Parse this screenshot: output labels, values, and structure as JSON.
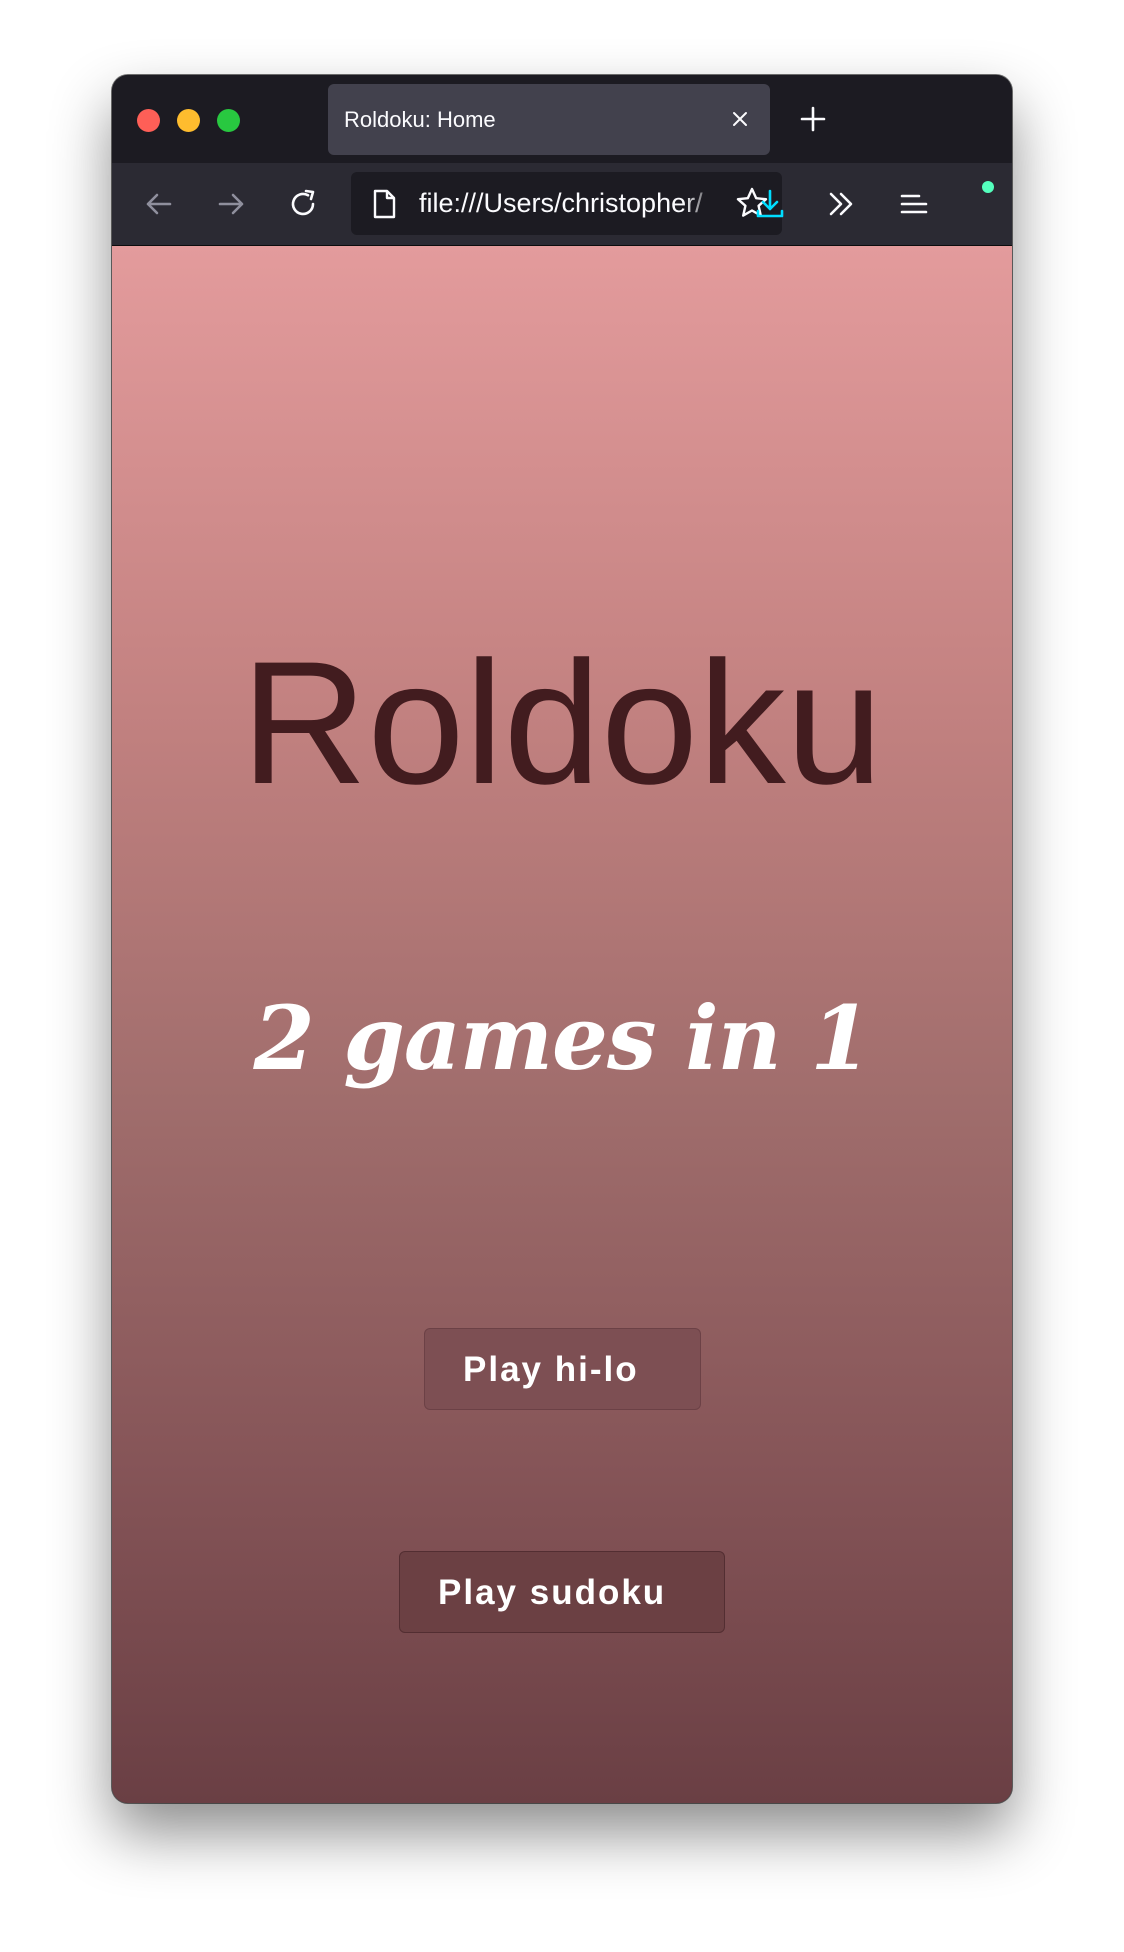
{
  "browser": {
    "tab_title": "Roldoku: Home",
    "url": "file:///Users/christopher/"
  },
  "icons": {
    "tab_close": "close-icon",
    "new_tab": "plus-icon",
    "back": "arrow-left-icon",
    "forward": "arrow-right-icon",
    "reload": "reload-icon",
    "page": "document-icon",
    "bookmark": "star-icon",
    "downloads": "download-icon",
    "overflow": "chevron-double-right-icon",
    "menu": "hamburger-menu-icon"
  },
  "page": {
    "title": "Roldoku",
    "subtitle": "2 games in 1",
    "buttons": {
      "hilo_label": "Play hi-lo",
      "sudoku_label": "Play sudoku"
    }
  },
  "colors": {
    "gradient_top": "#e39b9c",
    "gradient_bottom": "#6a3f44",
    "title_text": "#421c1f",
    "button_bg": "#7d4f53",
    "download_accent": "#00ddff",
    "notification_dot": "#54ffbd"
  }
}
